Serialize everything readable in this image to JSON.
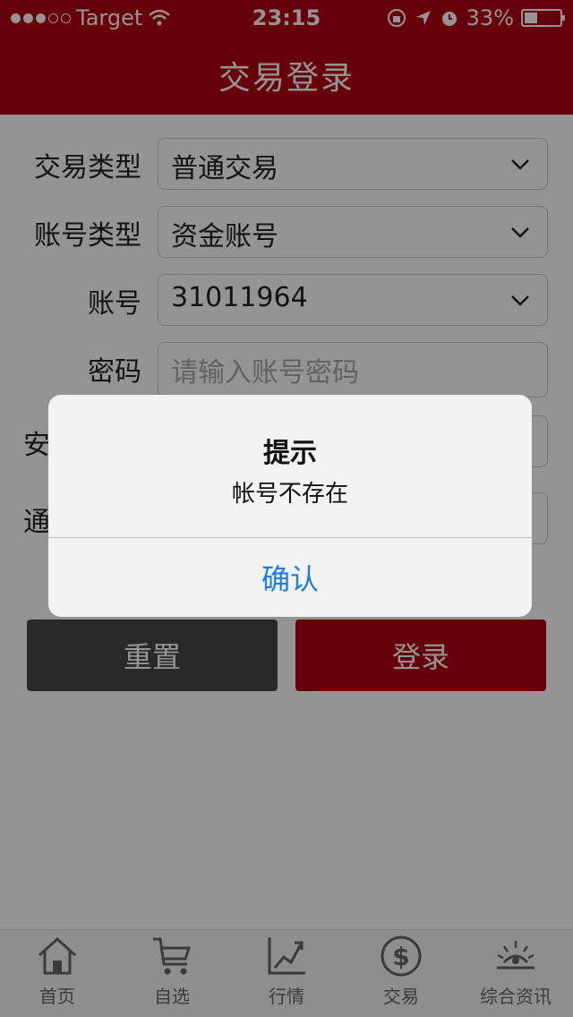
{
  "status_bar": {
    "carrier": "Target",
    "time": "23:15",
    "battery": "33%"
  },
  "nav": {
    "title": "交易登录"
  },
  "form": {
    "trade_type": {
      "label": "交易类型",
      "value": "普通交易"
    },
    "account_type": {
      "label": "账号类型",
      "value": "资金账号"
    },
    "account": {
      "label": "账号",
      "value": "31011964"
    },
    "password": {
      "label": "密码",
      "placeholder": "请输入账号密码"
    },
    "row5": {
      "label": "安"
    },
    "row6": {
      "label": "通"
    }
  },
  "buttons": {
    "reset": "重置",
    "login": "登录"
  },
  "tabs": [
    {
      "label": "首页",
      "icon": "home-icon"
    },
    {
      "label": "自选",
      "icon": "cart-icon"
    },
    {
      "label": "行情",
      "icon": "chart-icon"
    },
    {
      "label": "交易",
      "icon": "dollar-icon"
    },
    {
      "label": "综合资讯",
      "icon": "sunrise-icon"
    }
  ],
  "alert": {
    "title": "提示",
    "message": "帐号不存在",
    "confirm": "确认"
  },
  "colors": {
    "brand_red": "#b00010",
    "link_blue": "#1a7ee6"
  }
}
